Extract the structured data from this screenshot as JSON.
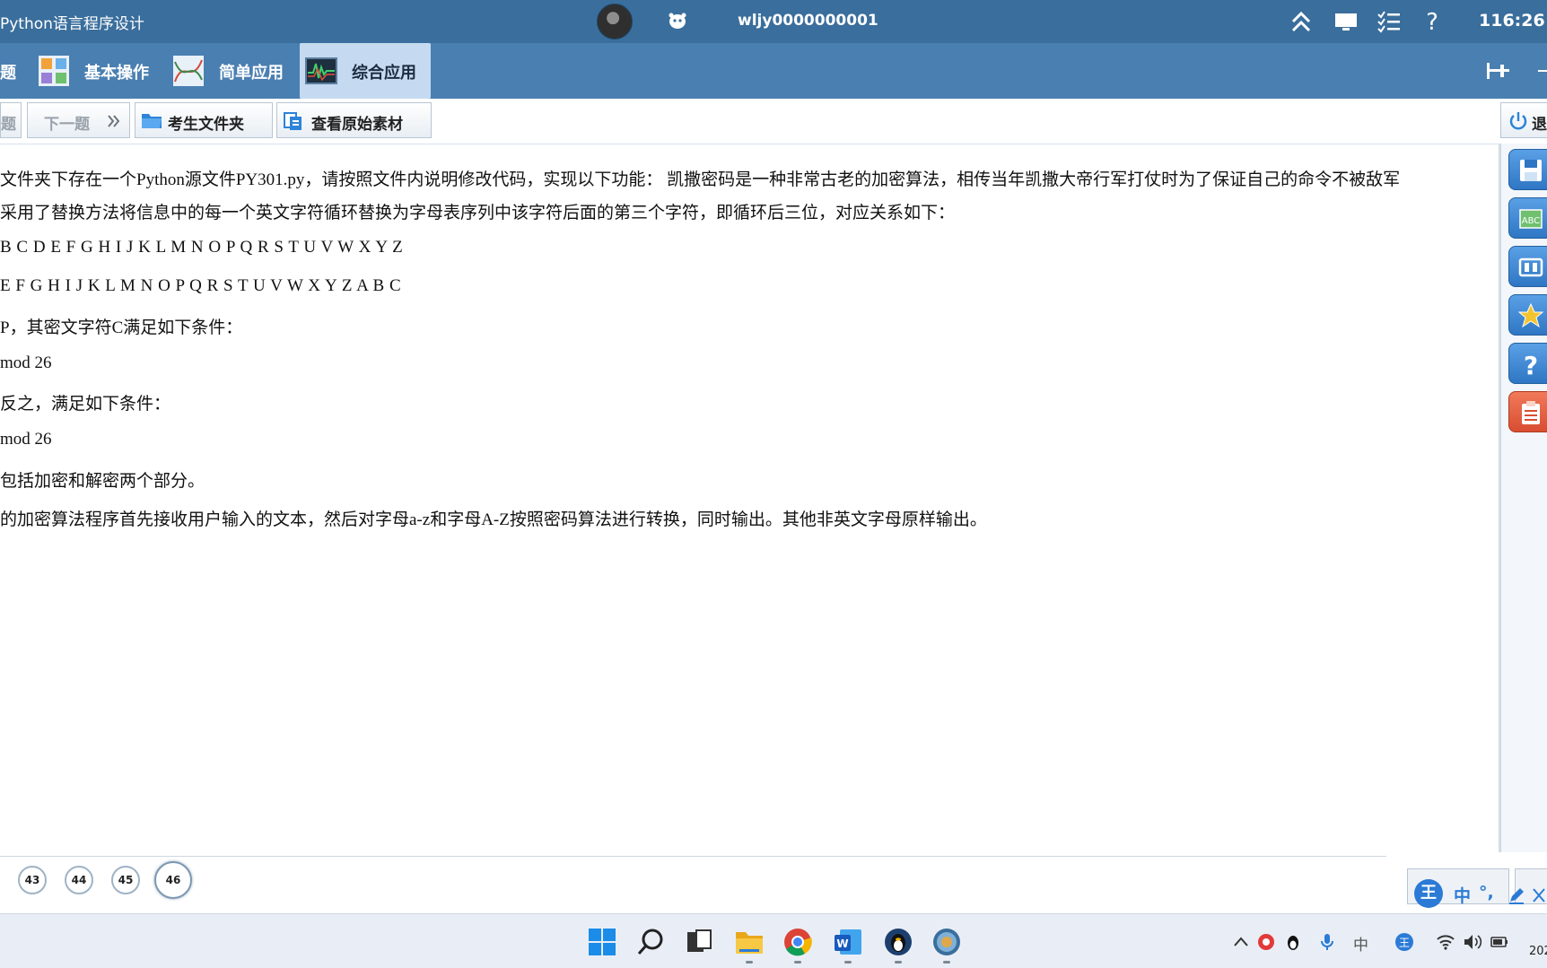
{
  "window": {
    "title": "Python语言程序设计",
    "user_id": "wljy0000000001",
    "clock": "116:26"
  },
  "tabs": [
    {
      "label": "题"
    },
    {
      "label": "基本操作"
    },
    {
      "label": "简单应用"
    },
    {
      "label": "综合应用"
    }
  ],
  "toolbar": {
    "prev_partial": "题",
    "next_label": "下一题",
    "student_folder_label": "考生文件夹",
    "view_material_label": "查看原始素材",
    "exit_partial": "退"
  },
  "question": {
    "lines": [
      "文件夹下存在一个Python源文件PY301.py，请按照文件内说明修改代码，实现以下功能： 凯撒密码是一种非常古老的加密算法，相传当年凯撒大帝行军打仗时为了保证自己的命令不被敌军",
      "采用了替换方法将信息中的每一个英文字符循环替换为字母表序列中该字符后面的第三个字符，即循环后三位，对应关系如下：",
      "B C D E F G H I J K L M N O P Q R S T U V W X Y Z",
      "E F G H I J K L M N O P Q R S T U V W X Y Z A B C",
      "P，其密文字符C满足如下条件：",
      "mod 26",
      "反之，满足如下条件：",
      "mod 26",
      "包括加密和解密两个部分。",
      "的加密算法程序首先接收用户输入的文本，然后对字母a-z和字母A-Z按照密码算法进行转换，同时输出。其他非英文字母原样输出。"
    ]
  },
  "question_nav": {
    "numbers": [
      "43",
      "44",
      "45",
      "46"
    ],
    "current": "46"
  },
  "ime": {
    "logo": "王",
    "mode": "中"
  },
  "taskbar": {
    "date_partial": "202",
    "tray_lang": "中"
  },
  "colors": {
    "titlebar": "#3a6e9c",
    "tabbar": "#4a7fb1",
    "active_tab": "#c5daf0",
    "side_button": "#2f76c4"
  }
}
